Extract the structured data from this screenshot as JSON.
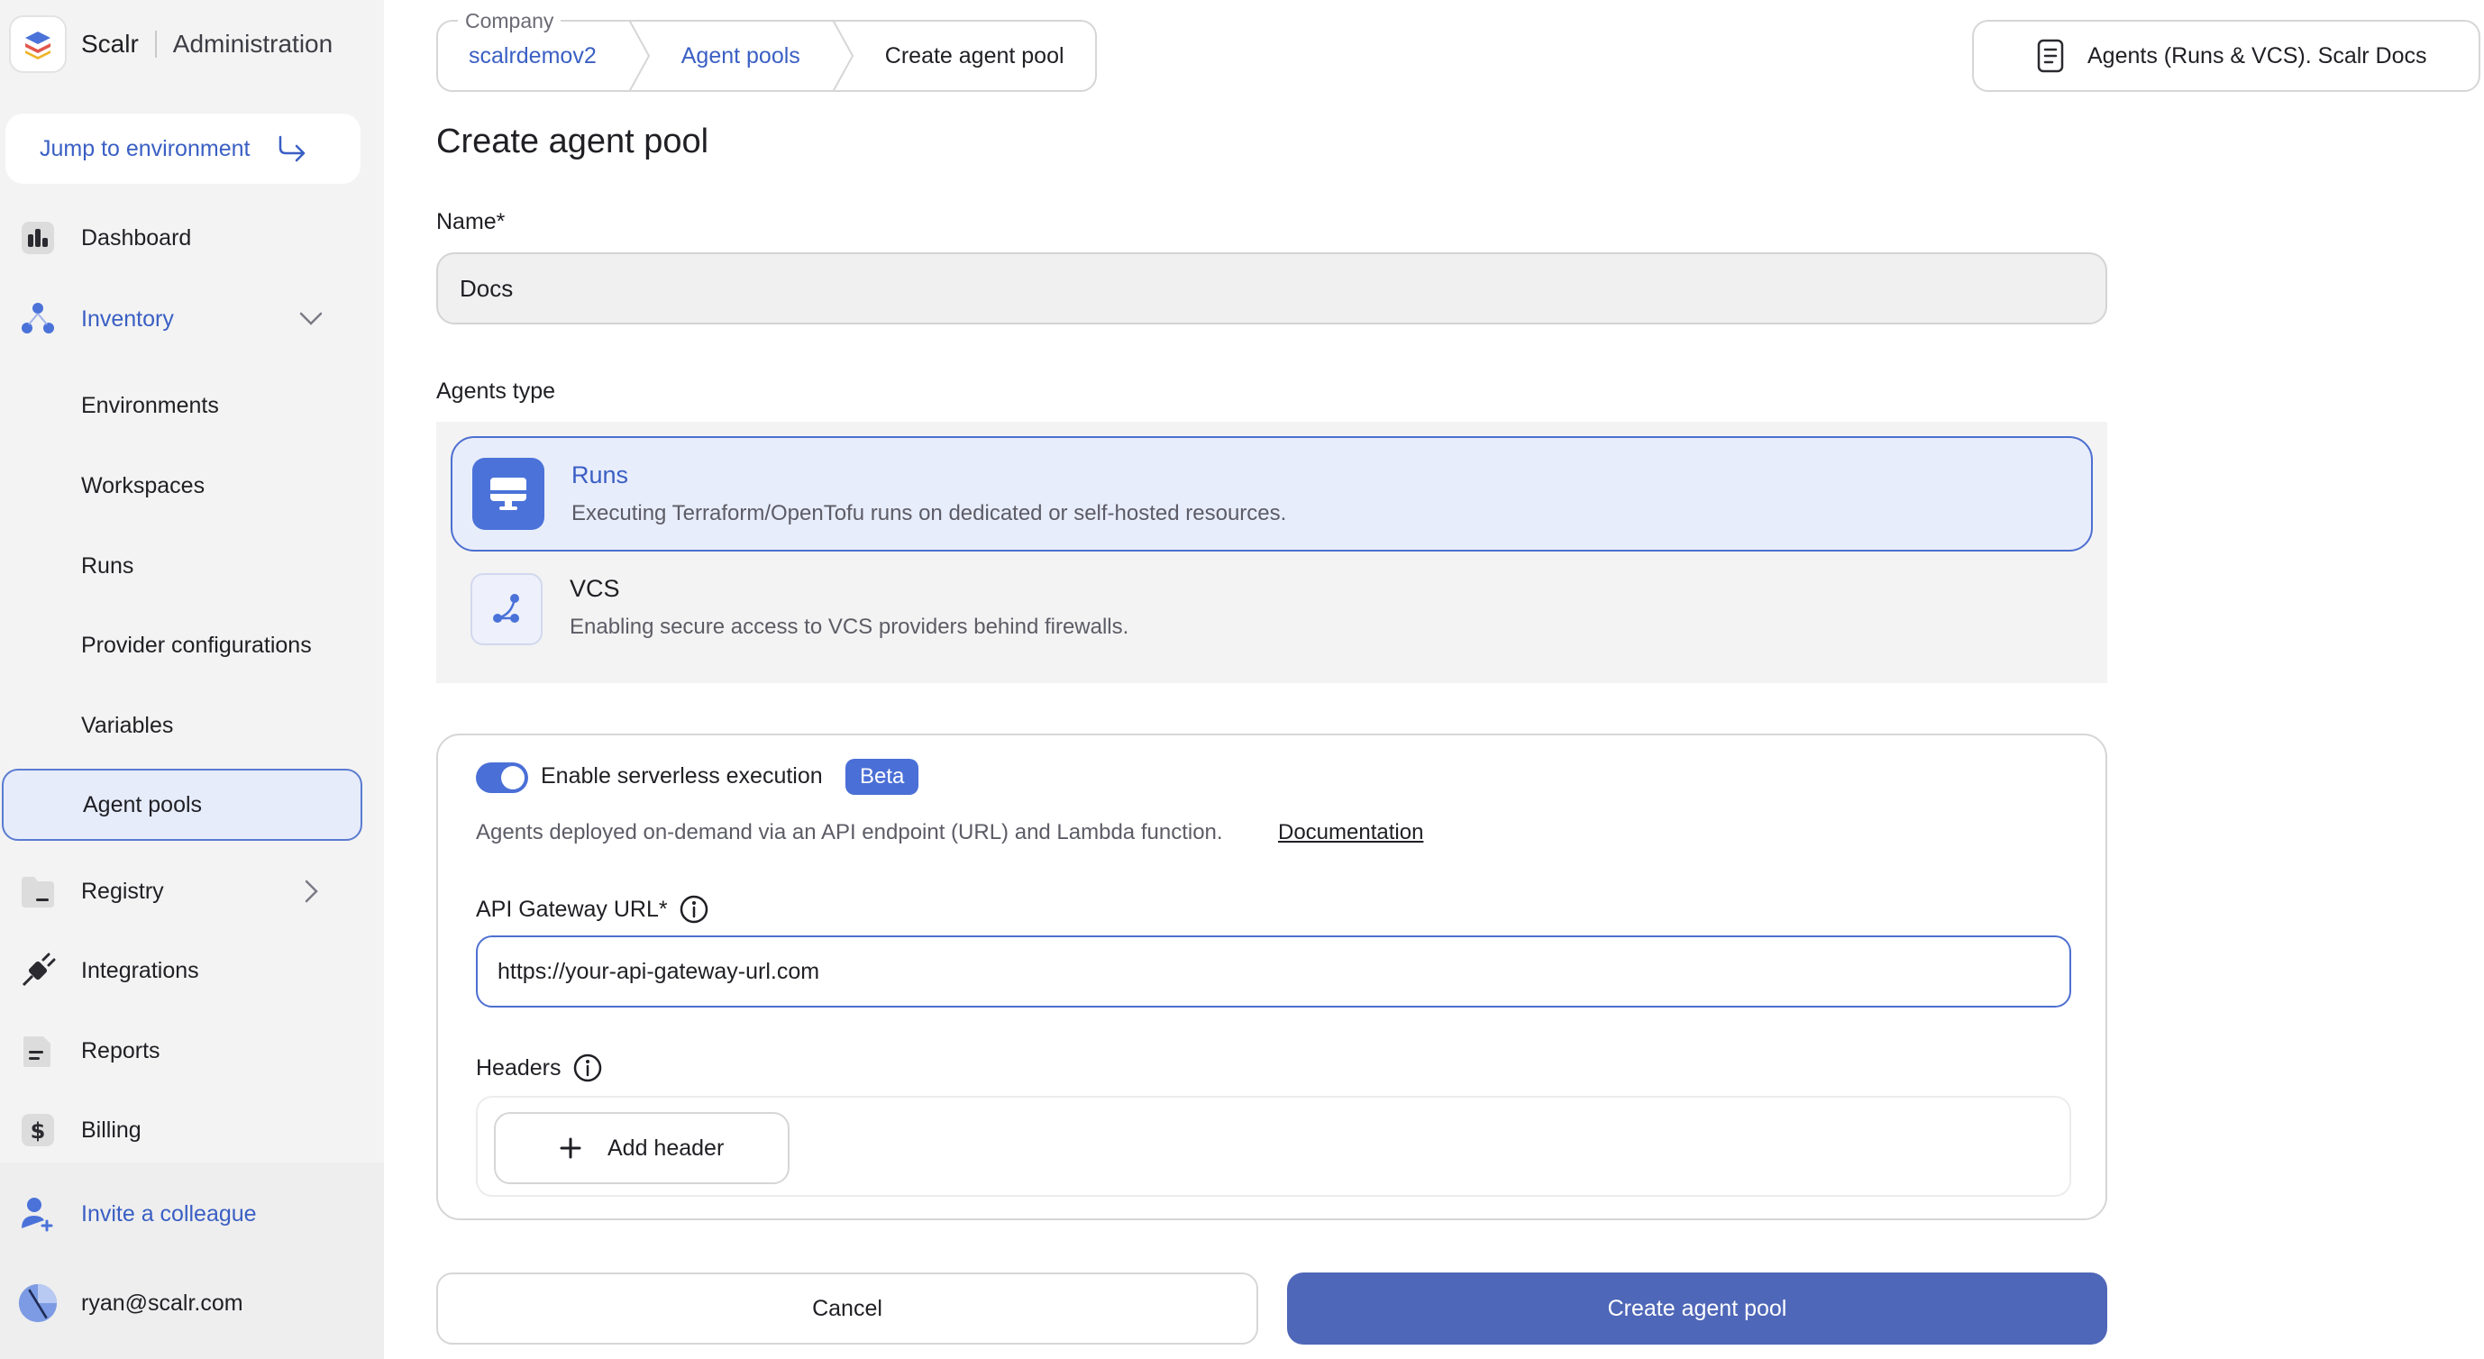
{
  "brand": {
    "name": "Scalr",
    "section": "Administration"
  },
  "sidebar": {
    "jump_label": "Jump to environment",
    "items": [
      {
        "label": "Dashboard",
        "icon": "dashboard-icon"
      },
      {
        "label": "Inventory",
        "icon": "inventory-icon"
      },
      {
        "label": "Environments"
      },
      {
        "label": "Workspaces"
      },
      {
        "label": "Runs"
      },
      {
        "label": "Provider configurations"
      },
      {
        "label": "Variables"
      },
      {
        "label": "Agent pools"
      },
      {
        "label": "Registry",
        "icon": "registry-icon"
      },
      {
        "label": "Integrations",
        "icon": "plug-icon"
      },
      {
        "label": "Reports",
        "icon": "report-icon"
      },
      {
        "label": "Billing",
        "icon": "dollar-icon"
      }
    ],
    "invite_label": "Invite a colleague",
    "user_email": "ryan@scalr.com"
  },
  "breadcrumb": {
    "legend": "Company",
    "items": [
      "scalrdemov2",
      "Agent pools",
      "Create agent pool"
    ]
  },
  "docs_button": "Agents (Runs & VCS). Scalr Docs",
  "page_title": "Create agent pool",
  "form": {
    "name_label": "Name*",
    "name_value": "Docs",
    "agents_type_label": "Agents type",
    "types": [
      {
        "title": "Runs",
        "description": "Executing Terraform/OpenTofu runs on dedicated or self-hosted resources.",
        "selected": true
      },
      {
        "title": "VCS",
        "description": "Enabling secure access to VCS providers behind firewalls.",
        "selected": false
      }
    ],
    "serverless": {
      "toggle_label": "Enable serverless execution",
      "enabled": true,
      "badge": "Beta",
      "description": "Agents deployed on-demand via an API endpoint (URL) and Lambda function.",
      "doc_link": "Documentation",
      "url_label": "API Gateway URL*",
      "url_value": "https://your-api-gateway-url.com",
      "headers_label": "Headers",
      "add_header_label": "Add header"
    },
    "cancel_label": "Cancel",
    "submit_label": "Create agent pool"
  },
  "colors": {
    "accent": "#4a6fd6",
    "primary_button": "#4f67b8",
    "selected_bg": "#e8edfb"
  }
}
